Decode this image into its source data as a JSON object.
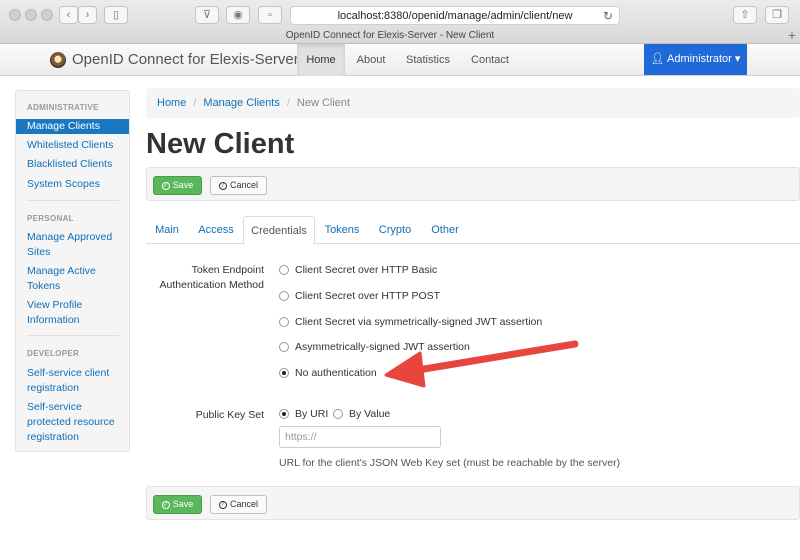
{
  "browser": {
    "url": "localhost:8380/openid/manage/admin/client/new",
    "tab_title": "OpenID Connect for Elexis-Server - New Client",
    "new_tab": "+"
  },
  "navbar": {
    "brand": "OpenID Connect for Elexis-Server",
    "items": [
      {
        "label": "Home",
        "active": true
      },
      {
        "label": "About"
      },
      {
        "label": "Statistics"
      },
      {
        "label": "Contact"
      }
    ],
    "user_menu": "Administrator"
  },
  "sidebar": {
    "admin_header": "ADMINISTRATIVE",
    "admin_items": [
      "Manage Clients",
      "Whitelisted Clients",
      "Blacklisted Clients",
      "System Scopes"
    ],
    "personal_header": "PERSONAL",
    "personal_items": [
      "Manage Approved Sites",
      "Manage Active Tokens",
      "View Profile Information"
    ],
    "developer_header": "DEVELOPER",
    "developer_items": [
      "Self-service client registration",
      "Self-service protected resource registration"
    ]
  },
  "breadcrumb": {
    "home": "Home",
    "manage": "Manage Clients",
    "current": "New Client"
  },
  "page_title": "New Client",
  "buttons": {
    "save": "Save",
    "cancel": "Cancel"
  },
  "tabs": [
    "Main",
    "Access",
    "Credentials",
    "Tokens",
    "Crypto",
    "Other"
  ],
  "active_tab": "Credentials",
  "form": {
    "token_auth_label": "Token Endpoint Authentication Method",
    "auth_options": [
      "Client Secret over HTTP Basic",
      "Client Secret over HTTP POST",
      "Client Secret via symmetrically-signed JWT assertion",
      "Asymmetrically-signed JWT assertion",
      "No authentication"
    ],
    "auth_selected": "No authentication",
    "public_key_label": "Public Key Set",
    "key_options": [
      "By URI",
      "By Value"
    ],
    "key_selected": "By URI",
    "jwks_placeholder": "https://",
    "jwks_help": "URL for the client's JSON Web Key set (must be reachable by the server)"
  },
  "colors": {
    "primary_blue": "#1f6ad8",
    "link": "#0e6fb8",
    "save_green": "#5bb75b",
    "annotation_arrow": "#e8453c"
  }
}
